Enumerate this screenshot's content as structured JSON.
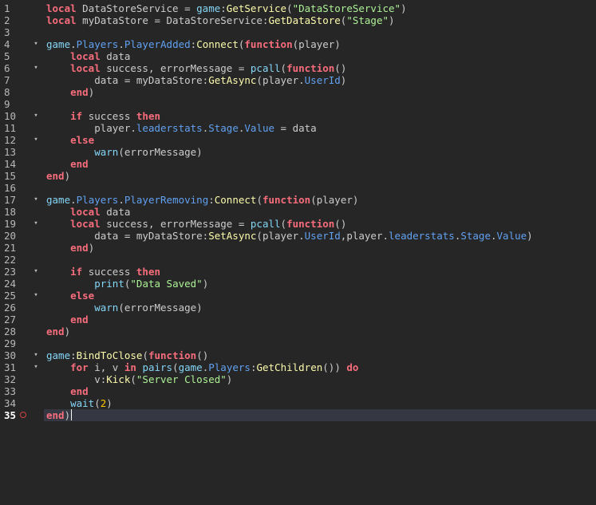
{
  "editor": {
    "current_line": 35,
    "lines": [
      {
        "n": "1",
        "fold": false,
        "tokens": [
          [
            "kw",
            "local"
          ],
          [
            "tx",
            " DataStoreService = "
          ],
          [
            "bi",
            "game"
          ],
          [
            "tx",
            ":"
          ],
          [
            "fn",
            "GetService"
          ],
          [
            "tx",
            "("
          ],
          [
            "st",
            "\"DataStoreService\""
          ],
          [
            "tx",
            ")"
          ]
        ]
      },
      {
        "n": "2",
        "fold": false,
        "tokens": [
          [
            "kw",
            "local"
          ],
          [
            "tx",
            " myDataStore = DataStoreService:"
          ],
          [
            "fn",
            "GetDataStore"
          ],
          [
            "tx",
            "("
          ],
          [
            "st",
            "\"Stage\""
          ],
          [
            "tx",
            ")"
          ]
        ]
      },
      {
        "n": "3",
        "fold": false,
        "tokens": []
      },
      {
        "n": "4",
        "fold": true,
        "tokens": [
          [
            "bi",
            "game"
          ],
          [
            "tx",
            "."
          ],
          [
            "pr",
            "Players"
          ],
          [
            "tx",
            "."
          ],
          [
            "pr",
            "PlayerAdded"
          ],
          [
            "tx",
            ":"
          ],
          [
            "fn",
            "Connect"
          ],
          [
            "tx",
            "("
          ],
          [
            "kw",
            "function"
          ],
          [
            "tx",
            "(player)"
          ]
        ]
      },
      {
        "n": "5",
        "fold": false,
        "tokens": [
          [
            "tx",
            "    "
          ],
          [
            "kw",
            "local"
          ],
          [
            "tx",
            " data"
          ]
        ]
      },
      {
        "n": "6",
        "fold": true,
        "tokens": [
          [
            "tx",
            "    "
          ],
          [
            "kw",
            "local"
          ],
          [
            "tx",
            " success, errorMessage = "
          ],
          [
            "bi",
            "pcall"
          ],
          [
            "tx",
            "("
          ],
          [
            "kw",
            "function"
          ],
          [
            "tx",
            "()"
          ]
        ]
      },
      {
        "n": "7",
        "fold": false,
        "tokens": [
          [
            "tx",
            "        data = myDataStore:"
          ],
          [
            "fn",
            "GetAsync"
          ],
          [
            "tx",
            "(player."
          ],
          [
            "pr",
            "UserId"
          ],
          [
            "tx",
            ")"
          ]
        ]
      },
      {
        "n": "8",
        "fold": false,
        "tokens": [
          [
            "tx",
            "    "
          ],
          [
            "kw",
            "end"
          ],
          [
            "tx",
            ")"
          ]
        ]
      },
      {
        "n": "9",
        "fold": false,
        "tokens": []
      },
      {
        "n": "10",
        "fold": true,
        "tokens": [
          [
            "tx",
            "    "
          ],
          [
            "kw",
            "if"
          ],
          [
            "tx",
            " success "
          ],
          [
            "kw",
            "then"
          ]
        ]
      },
      {
        "n": "11",
        "fold": false,
        "tokens": [
          [
            "tx",
            "        player."
          ],
          [
            "pr",
            "leaderstats"
          ],
          [
            "tx",
            "."
          ],
          [
            "pr",
            "Stage"
          ],
          [
            "tx",
            "."
          ],
          [
            "pr",
            "Value"
          ],
          [
            "tx",
            " = data"
          ]
        ]
      },
      {
        "n": "12",
        "fold": true,
        "tokens": [
          [
            "tx",
            "    "
          ],
          [
            "kw",
            "else"
          ]
        ]
      },
      {
        "n": "13",
        "fold": false,
        "tokens": [
          [
            "tx",
            "        "
          ],
          [
            "bi",
            "warn"
          ],
          [
            "tx",
            "(errorMessage)"
          ]
        ]
      },
      {
        "n": "14",
        "fold": false,
        "tokens": [
          [
            "tx",
            "    "
          ],
          [
            "kw",
            "end"
          ]
        ]
      },
      {
        "n": "15",
        "fold": false,
        "tokens": [
          [
            "kw",
            "end"
          ],
          [
            "tx",
            ")"
          ]
        ]
      },
      {
        "n": "16",
        "fold": false,
        "tokens": []
      },
      {
        "n": "17",
        "fold": true,
        "tokens": [
          [
            "bi",
            "game"
          ],
          [
            "tx",
            "."
          ],
          [
            "pr",
            "Players"
          ],
          [
            "tx",
            "."
          ],
          [
            "pr",
            "PlayerRemoving"
          ],
          [
            "tx",
            ":"
          ],
          [
            "fn",
            "Connect"
          ],
          [
            "tx",
            "("
          ],
          [
            "kw",
            "function"
          ],
          [
            "tx",
            "(player)"
          ]
        ]
      },
      {
        "n": "18",
        "fold": false,
        "tokens": [
          [
            "tx",
            "    "
          ],
          [
            "kw",
            "local"
          ],
          [
            "tx",
            " data"
          ]
        ]
      },
      {
        "n": "19",
        "fold": true,
        "tokens": [
          [
            "tx",
            "    "
          ],
          [
            "kw",
            "local"
          ],
          [
            "tx",
            " success, errorMessage = "
          ],
          [
            "bi",
            "pcall"
          ],
          [
            "tx",
            "("
          ],
          [
            "kw",
            "function"
          ],
          [
            "tx",
            "()"
          ]
        ]
      },
      {
        "n": "20",
        "fold": false,
        "tokens": [
          [
            "tx",
            "        data = myDataStore:"
          ],
          [
            "fn",
            "SetAsync"
          ],
          [
            "tx",
            "(player."
          ],
          [
            "pr",
            "UserId"
          ],
          [
            "tx",
            ",player."
          ],
          [
            "pr",
            "leaderstats"
          ],
          [
            "tx",
            "."
          ],
          [
            "pr",
            "Stage"
          ],
          [
            "tx",
            "."
          ],
          [
            "pr",
            "Value"
          ],
          [
            "tx",
            ")"
          ]
        ]
      },
      {
        "n": "21",
        "fold": false,
        "tokens": [
          [
            "tx",
            "    "
          ],
          [
            "kw",
            "end"
          ],
          [
            "tx",
            ")"
          ]
        ]
      },
      {
        "n": "22",
        "fold": false,
        "tokens": []
      },
      {
        "n": "23",
        "fold": true,
        "tokens": [
          [
            "tx",
            "    "
          ],
          [
            "kw",
            "if"
          ],
          [
            "tx",
            " success "
          ],
          [
            "kw",
            "then"
          ]
        ]
      },
      {
        "n": "24",
        "fold": false,
        "tokens": [
          [
            "tx",
            "        "
          ],
          [
            "bi",
            "print"
          ],
          [
            "tx",
            "("
          ],
          [
            "st",
            "\"Data Saved\""
          ],
          [
            "tx",
            ")"
          ]
        ]
      },
      {
        "n": "25",
        "fold": true,
        "tokens": [
          [
            "tx",
            "    "
          ],
          [
            "kw",
            "else"
          ]
        ]
      },
      {
        "n": "26",
        "fold": false,
        "tokens": [
          [
            "tx",
            "        "
          ],
          [
            "bi",
            "warn"
          ],
          [
            "tx",
            "(errorMessage)"
          ]
        ]
      },
      {
        "n": "27",
        "fold": false,
        "tokens": [
          [
            "tx",
            "    "
          ],
          [
            "kw",
            "end"
          ]
        ]
      },
      {
        "n": "28",
        "fold": false,
        "tokens": [
          [
            "kw",
            "end"
          ],
          [
            "tx",
            ")"
          ]
        ]
      },
      {
        "n": "29",
        "fold": false,
        "tokens": []
      },
      {
        "n": "30",
        "fold": true,
        "tokens": [
          [
            "bi",
            "game"
          ],
          [
            "tx",
            ":"
          ],
          [
            "fn",
            "BindToClose"
          ],
          [
            "tx",
            "("
          ],
          [
            "kw",
            "function"
          ],
          [
            "tx",
            "()"
          ]
        ]
      },
      {
        "n": "31",
        "fold": true,
        "tokens": [
          [
            "tx",
            "    "
          ],
          [
            "kw",
            "for"
          ],
          [
            "tx",
            " i, v "
          ],
          [
            "kw",
            "in"
          ],
          [
            "tx",
            " "
          ],
          [
            "bi",
            "pairs"
          ],
          [
            "tx",
            "("
          ],
          [
            "bi",
            "game"
          ],
          [
            "tx",
            "."
          ],
          [
            "pr",
            "Players"
          ],
          [
            "tx",
            ":"
          ],
          [
            "fn",
            "GetChildren"
          ],
          [
            "tx",
            "()) "
          ],
          [
            "kw",
            "do"
          ]
        ]
      },
      {
        "n": "32",
        "fold": false,
        "tokens": [
          [
            "tx",
            "        v:"
          ],
          [
            "fn",
            "Kick"
          ],
          [
            "tx",
            "("
          ],
          [
            "st",
            "\"Server Closed\""
          ],
          [
            "tx",
            ")"
          ]
        ]
      },
      {
        "n": "33",
        "fold": false,
        "tokens": [
          [
            "tx",
            "    "
          ],
          [
            "kw",
            "end"
          ]
        ]
      },
      {
        "n": "34",
        "fold": false,
        "tokens": [
          [
            "tx",
            "    "
          ],
          [
            "bi",
            "wait"
          ],
          [
            "tx",
            "("
          ],
          [
            "nu",
            "2"
          ],
          [
            "tx",
            ")"
          ]
        ]
      },
      {
        "n": "35",
        "fold": false,
        "tokens": [
          [
            "kw",
            "end"
          ],
          [
            "tx",
            ")"
          ]
        ]
      }
    ]
  },
  "colors": {
    "background": "#262626",
    "keyword": "#f86d7c",
    "builtin": "#84d6f7",
    "method": "#fdfbac",
    "string": "#adf195",
    "number": "#ffc600",
    "property": "#61a1f1",
    "text": "#cccccc",
    "current_line_highlight": "#353842",
    "breakpoint": "#d04040"
  },
  "icons": {
    "fold": "chevron-down-icon",
    "breakpoint": "breakpoint-icon"
  }
}
